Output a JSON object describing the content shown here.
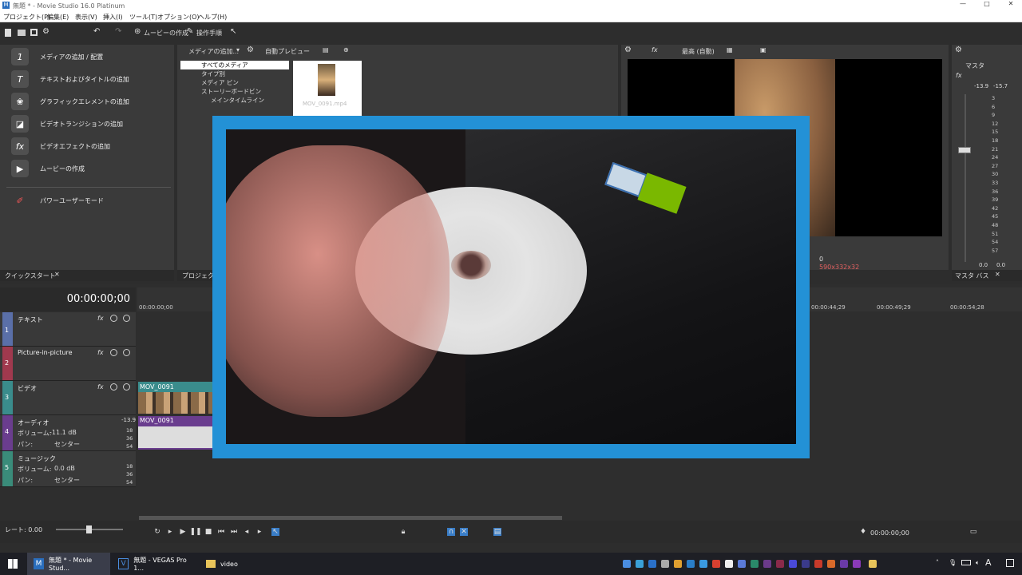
{
  "window": {
    "title": "無題 * - Movie Studio 16.0 Platinum"
  },
  "menu": [
    "プロジェクト(P)",
    "編集(E)",
    "表示(V)",
    "挿入(I)",
    "ツール(T)",
    "オプション(O)",
    "ヘルプ(H)"
  ],
  "toolbar": {
    "make_movie": "ムービーの作成",
    "steps": "操作手順"
  },
  "quickstart": {
    "items": [
      "メディアの追加 / 配置",
      "テキストおよびタイトルの追加",
      "グラフィックエレメントの追加",
      "ビデオトランジションの追加",
      "ビデオエフェクトの追加",
      "ムービーの作成",
      "パワーユーザーモード"
    ],
    "tab": "クイックスタート"
  },
  "media": {
    "toolbar_label": "メディアの追加...",
    "auto_preview": "自動プレビュー",
    "tree": [
      "すべてのメディア",
      "タイプ別",
      "メディア ビン",
      "ストーリーボードビン",
      "メインタイムライン"
    ],
    "thumb_label": "MOV_0091.mp4",
    "tab": "プロジェクト メ"
  },
  "preview": {
    "quality": "最高 (自動)",
    "frame": "0",
    "size": "590x332x32"
  },
  "master": {
    "label": "マスタ",
    "peak_l": "-13.9",
    "peak_r": "-15.7",
    "scale": [
      "3",
      "6",
      "9",
      "12",
      "15",
      "18",
      "21",
      "24",
      "27",
      "30",
      "33",
      "36",
      "39",
      "42",
      "45",
      "48",
      "51",
      "54",
      "57"
    ],
    "bottom_l": "0.0",
    "bottom_r": "0.0",
    "tab": "マスタ バス"
  },
  "timeline": {
    "timecode": "00:00:00;00",
    "ruler": [
      "00:00:00;00",
      "00:00:44;29",
      "00:00:49;29",
      "00:00:54;28"
    ],
    "tracks": [
      {
        "name": "テキスト",
        "num": "1"
      },
      {
        "name": "Picture-in-picture",
        "num": "2"
      },
      {
        "name": "ビデオ",
        "num": "3",
        "clip": "MOV_0091"
      },
      {
        "name": "オーディオ",
        "num": "4",
        "clip": "MOV_0091",
        "vol_label": "ボリューム:",
        "vol": "-11.1 dB",
        "pan_label": "パン:",
        "pan": "センター",
        "peak": "-13.9"
      },
      {
        "name": "ミュージック",
        "num": "5",
        "vol_label": "ボリューム:",
        "vol": "0.0 dB",
        "pan_label": "パン:",
        "pan": "センター"
      }
    ],
    "db_marks": [
      "18",
      "36",
      "54"
    ]
  },
  "transport": {
    "rate": "レート: 0.00",
    "cursor": "00:00:00;00"
  },
  "taskbar": {
    "tasks": [
      "無題 * - Movie Stud...",
      "無題 - VEGAS Pro 1...",
      "video"
    ],
    "ime": "A"
  },
  "colors": {
    "overlay_frame": "#2391d6",
    "text_track": "#5a6fa8",
    "pip_track": "#a0394e",
    "video_track": "#3a8c8c",
    "audio_track": "#6a3d8e",
    "music_track": "#3a8c7a"
  }
}
